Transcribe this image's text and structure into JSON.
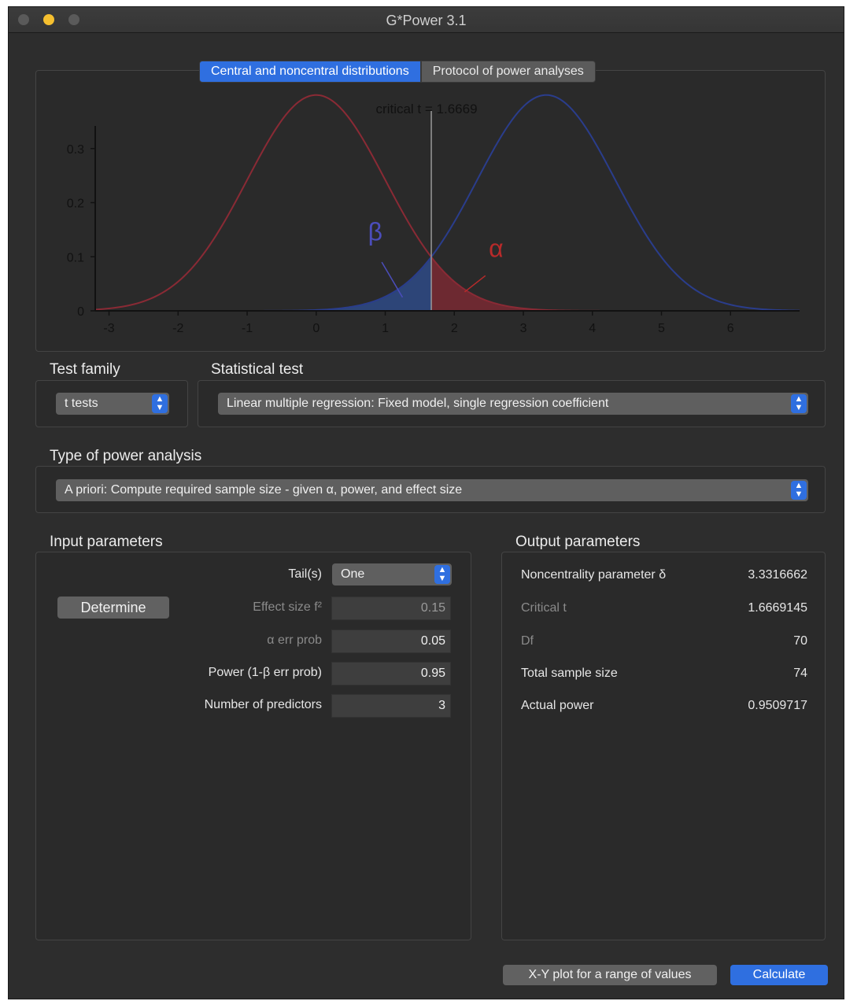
{
  "window": {
    "title": "G*Power 3.1"
  },
  "tabs": [
    {
      "label": "Central and noncentral distributions",
      "active": true
    },
    {
      "label": "Protocol of power analyses",
      "active": false
    }
  ],
  "chart_data": {
    "type": "line",
    "title": "critical t = 1.6669",
    "critical_t": 1.6669,
    "noncentrality": 3.3316662,
    "df": 70,
    "xlim": [
      -3.2,
      7
    ],
    "ylim": [
      0,
      0.4
    ],
    "x_ticks": [
      "-3",
      "-2",
      "-1",
      "0",
      "1",
      "2",
      "3",
      "4",
      "5",
      "6"
    ],
    "y_ticks": [
      "0",
      "0.1",
      "0.2",
      "0.3"
    ],
    "annotations": [
      "β",
      "α"
    ],
    "series": [
      {
        "distribution": "central t",
        "color": "#8a2a35"
      },
      {
        "distribution": "noncentral t",
        "color": "#2a3d8c"
      }
    ]
  },
  "test_family": {
    "label": "Test family",
    "value": "t tests"
  },
  "statistical_test": {
    "label": "Statistical test",
    "value": "Linear multiple regression: Fixed model, single regression coefficient"
  },
  "power_analysis": {
    "label": "Type of power analysis",
    "value": "A priori: Compute required sample size - given α, power, and effect size"
  },
  "input": {
    "label": "Input parameters",
    "determine": "Determine",
    "tails_label": "Tail(s)",
    "tails_value": "One",
    "effect_label": "Effect size f²",
    "effect_value": "0.15",
    "alpha_label": "α err prob",
    "alpha_value": "0.05",
    "power_label": "Power (1-β err prob)",
    "power_value": "0.95",
    "predictors_label": "Number of predictors",
    "predictors_value": "3"
  },
  "output": {
    "label": "Output parameters",
    "rows": [
      {
        "label": "Noncentrality parameter δ",
        "value": "3.3316662",
        "dim": false
      },
      {
        "label": "Critical t",
        "value": "1.6669145",
        "dim": true
      },
      {
        "label": "Df",
        "value": "70",
        "dim": true
      },
      {
        "label": "Total sample size",
        "value": "74",
        "dim": false
      },
      {
        "label": "Actual power",
        "value": "0.9509717",
        "dim": false
      }
    ]
  },
  "buttons": {
    "xy_plot": "X-Y plot for a range of values",
    "calculate": "Calculate"
  }
}
